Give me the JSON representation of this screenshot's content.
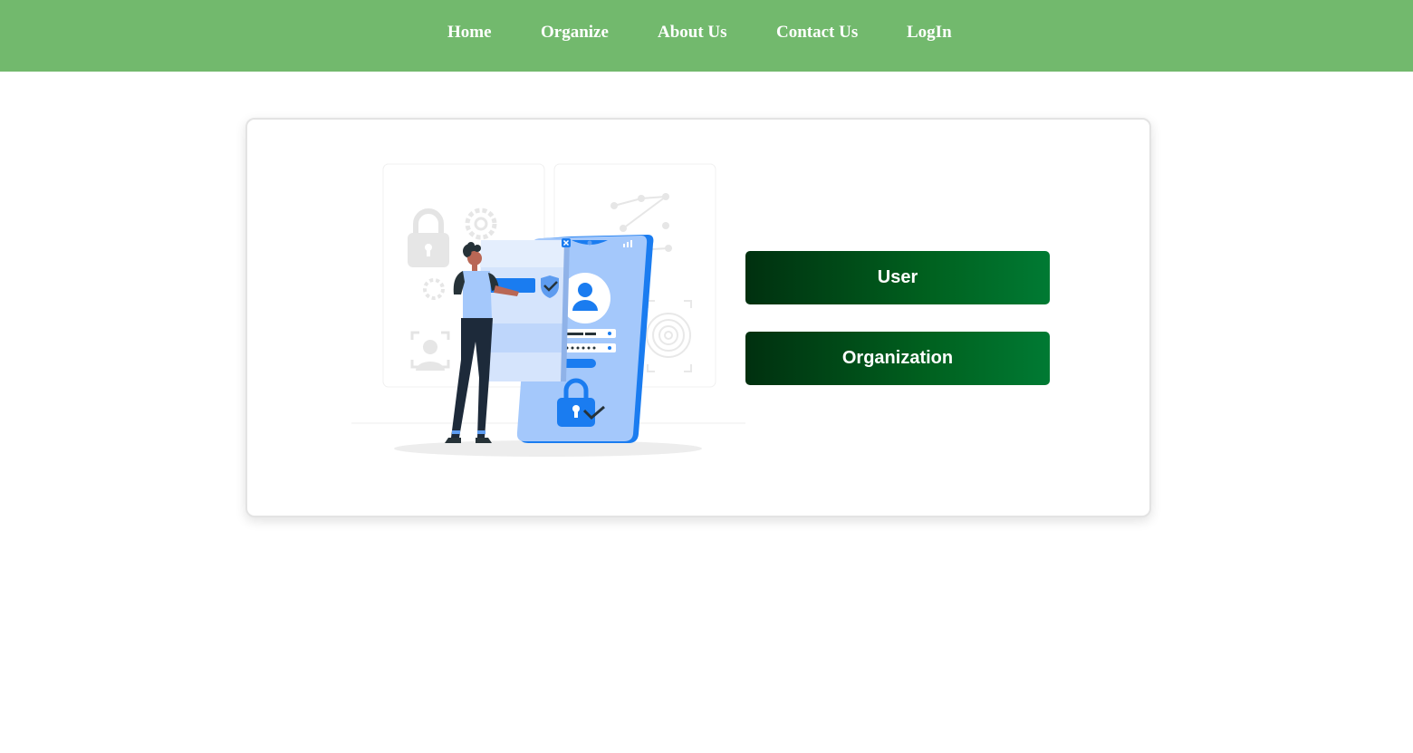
{
  "nav": {
    "items": [
      {
        "label": "Home"
      },
      {
        "label": "Organize"
      },
      {
        "label": "About Us"
      },
      {
        "label": "Contact Us"
      },
      {
        "label": "LogIn"
      }
    ]
  },
  "card": {
    "illustration": "login-security-illustration",
    "buttons": {
      "user_label": "User",
      "organization_label": "Organization"
    }
  },
  "colors": {
    "navbar": "#72b96d",
    "button_gradient_start": "#00300f",
    "button_gradient_end": "#007a33",
    "illustration_accent": "#1a7cf0"
  }
}
